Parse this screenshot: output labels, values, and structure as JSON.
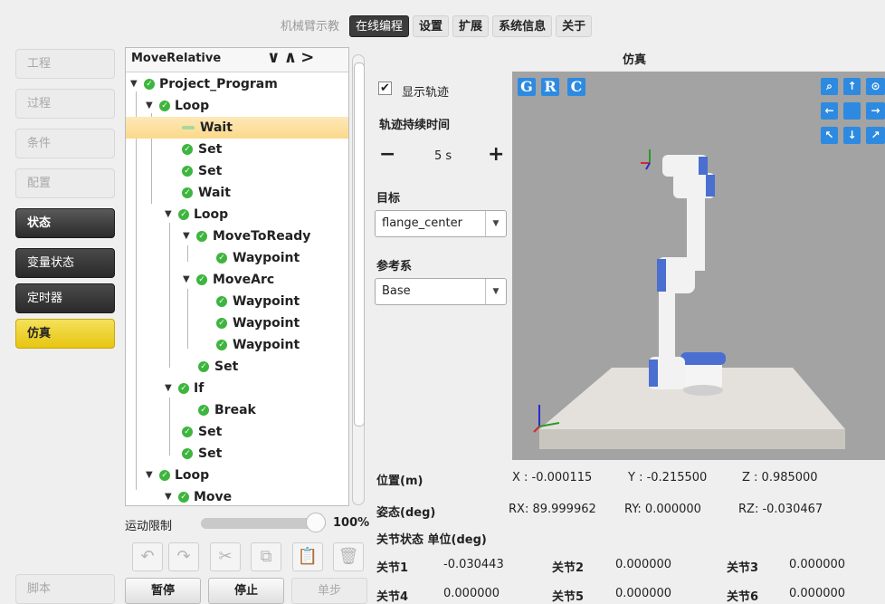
{
  "topmenu": [
    "机械臂示教",
    "在线编程",
    "设置",
    "扩展",
    "系统信息",
    "关于"
  ],
  "nav": {
    "items": [
      "工程",
      "过程",
      "条件",
      "配置"
    ],
    "status": "状态",
    "sub": [
      "变量状态",
      "定时器",
      "仿真"
    ],
    "script": "脚本"
  },
  "tree": {
    "header": "MoveRelative",
    "header_arrows": "∨∧>",
    "rows": [
      "Project_Program",
      "Loop",
      "Wait",
      "Set",
      "Set",
      "Wait",
      "Loop",
      "MoveToReady",
      "Waypoint",
      "MoveArc",
      "Waypoint",
      "Waypoint",
      "Waypoint",
      "Set",
      "If",
      "Break",
      "Set",
      "Set",
      "Loop",
      "Move"
    ]
  },
  "speed": {
    "label": "运动限制",
    "value": "100%",
    "fraction": 1.0
  },
  "controls": {
    "pause": "暂停",
    "stop": "停止",
    "step": "单步"
  },
  "sim_panel": {
    "title": "仿真",
    "show_trace": "显示轨迹",
    "trace_duration_label": "轨迹持续时间",
    "minus": "−",
    "duration": "5 s",
    "plus": "+",
    "target_label": "目标",
    "target_value": "flange_center",
    "frame_label": "参考系",
    "frame_value": "Base",
    "grc": [
      "G",
      "R",
      "C"
    ]
  },
  "position": {
    "label": "位置(m)",
    "x": "X : -0.000115",
    "y": "Y : -0.215500",
    "z": "Z : 0.985000"
  },
  "pose": {
    "label": "姿态(deg)",
    "rx": "RX: 89.999962",
    "ry": "RY: 0.000000",
    "rz": "RZ: -0.030467"
  },
  "joints": {
    "label": "关节状态 单位(deg)",
    "j1": "关节1",
    "v1": "-0.030443",
    "j2": "关节2",
    "v2": "0.000000",
    "j3": "关节3",
    "v3": "0.000000",
    "j4": "关节4",
    "v4": "0.000000",
    "j5": "关节5",
    "v5": "0.000000",
    "j6": "关节6",
    "v6": "0.000000"
  }
}
